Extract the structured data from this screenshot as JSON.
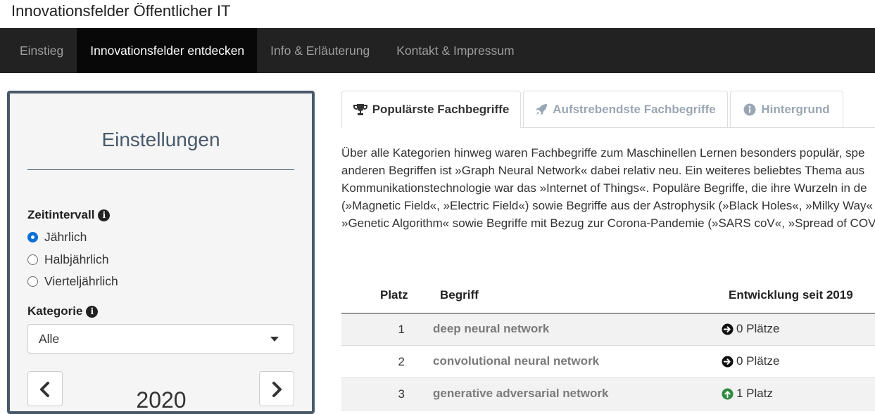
{
  "app": {
    "title": "Innovationsfelder Öffentlicher IT"
  },
  "nav": {
    "items": [
      {
        "label": "Einstieg"
      },
      {
        "label": "Innovationsfelder entdecken",
        "active": true
      },
      {
        "label": "Info & Erläuterung"
      },
      {
        "label": "Kontakt & Impressum"
      }
    ]
  },
  "settings": {
    "title": "Einstellungen",
    "zeitintervall_label": "Zeitintervall",
    "intervals": [
      {
        "label": "Jährlich",
        "checked": true
      },
      {
        "label": "Halbjährlich",
        "checked": false
      },
      {
        "label": "Vierteljährlich",
        "checked": false
      }
    ],
    "kategorie_label": "Kategorie",
    "kategorie_value": "Alle",
    "year": "2020"
  },
  "tabs": [
    {
      "label": "Populärste Fachbegriffe",
      "icon": "trophy-icon",
      "active": true
    },
    {
      "label": "Aufstrebendste Fachbegriffe",
      "icon": "rocket-icon",
      "active": false
    },
    {
      "label": "Hintergrund",
      "icon": "info-circle-icon",
      "active": false
    }
  ],
  "description": {
    "lines": [
      "Über alle Kategorien hinweg waren Fachbegriffe zum Maschinellen Lernen besonders populär, spe",
      "anderen Begriffen ist »Graph Neural Network« dabei relativ neu. Ein weiteres beliebtes Thema aus",
      "Kommunikationstechnologie war das »Internet of Things«. Populäre Begriffe, die ihre Wurzeln in de",
      "(»Magnetic Field«, »Electric Field«) sowie Begriffe aus der Astrophysik (»Black Holes«, »Milky Way«",
      "»Genetic Algorithm« sowie Begriffe mit Bezug zur Corona-Pandemie (»SARS coV«, »Spread of COV"
    ]
  },
  "table": {
    "headers": {
      "rank": "Platz",
      "term": "Begriff",
      "development": "Entwicklung seit 2019"
    },
    "rows": [
      {
        "rank": "1",
        "term": "deep neural network",
        "development": "0 Plätze",
        "trend": "neutral"
      },
      {
        "rank": "2",
        "term": "convolutional neural network",
        "development": "0 Plätze",
        "trend": "neutral"
      },
      {
        "rank": "3",
        "term": "generative adversarial network",
        "development": "1 Platz",
        "trend": "up"
      }
    ]
  },
  "colors": {
    "accent": "#485a6a",
    "navbar": "#222222",
    "up": "#2e8b3e"
  }
}
